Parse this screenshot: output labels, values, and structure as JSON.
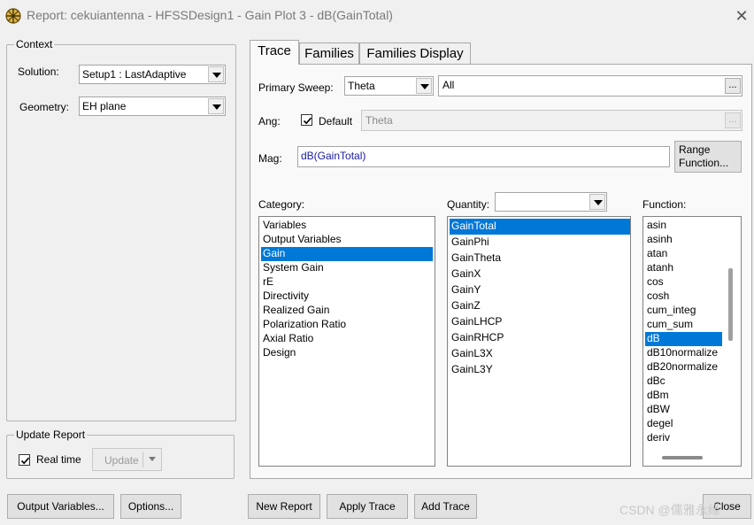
{
  "window": {
    "title": "Report: cekuiantenna - HFSSDesign1 - Gain Plot 3 - dB(GainTotal)",
    "close_glyph": "✕"
  },
  "context": {
    "group_label": "Context",
    "solution_label": "Solution:",
    "solution_value": "Setup1 : LastAdaptive",
    "geometry_label": "Geometry:",
    "geometry_value": "EH plane"
  },
  "update_report": {
    "group_label": "Update Report",
    "realtime_label": "Real time",
    "realtime_checked": true,
    "update_button": "Update"
  },
  "tabs": [
    {
      "label": "Trace",
      "active": true
    },
    {
      "label": "Families",
      "active": false
    },
    {
      "label": "Families Display",
      "active": false
    }
  ],
  "trace": {
    "primary_sweep_label": "Primary Sweep:",
    "primary_sweep_value": "Theta",
    "sweep_range_value": "All",
    "ang_label": "Ang:",
    "default_label": "Default",
    "default_checked": true,
    "ang_value": "Theta",
    "mag_label": "Mag:",
    "mag_value": "dB(GainTotal)",
    "range_function_line1": "Range",
    "range_function_line2": "Function...",
    "ellipsis": "..."
  },
  "category": {
    "label": "Category:",
    "items": [
      "Variables",
      "Output Variables",
      "Gain",
      "System Gain",
      "rE",
      "Directivity",
      "Realized Gain",
      "Polarization Ratio",
      "Axial Ratio",
      "Design"
    ],
    "selected": "Gain"
  },
  "quantity": {
    "label": "Quantity:",
    "filter_value": "",
    "items": [
      "GainTotal",
      "GainPhi",
      "GainTheta",
      "GainX",
      "GainY",
      "GainZ",
      "GainLHCP",
      "GainRHCP",
      "GainL3X",
      "GainL3Y"
    ],
    "selected": "GainTotal"
  },
  "function": {
    "label": "Function:",
    "items": [
      "asin",
      "asinh",
      "atan",
      "atanh",
      "cos",
      "cosh",
      "cum_integ",
      "cum_sum",
      "dB",
      "dB10normalize",
      "dB20normalize",
      "dBc",
      "dBm",
      "dBW",
      "degel",
      "deriv"
    ],
    "selected": "dB"
  },
  "bottom_buttons": {
    "output_variables": "Output Variables...",
    "options": "Options...",
    "new_report": "New Report",
    "apply_trace": "Apply Trace",
    "add_trace": "Add Trace",
    "close": "Close"
  },
  "watermark": "CSDN @儒雅永缘",
  "colors": {
    "selection": "#0078d7",
    "mag_text": "#1a1aa6"
  }
}
